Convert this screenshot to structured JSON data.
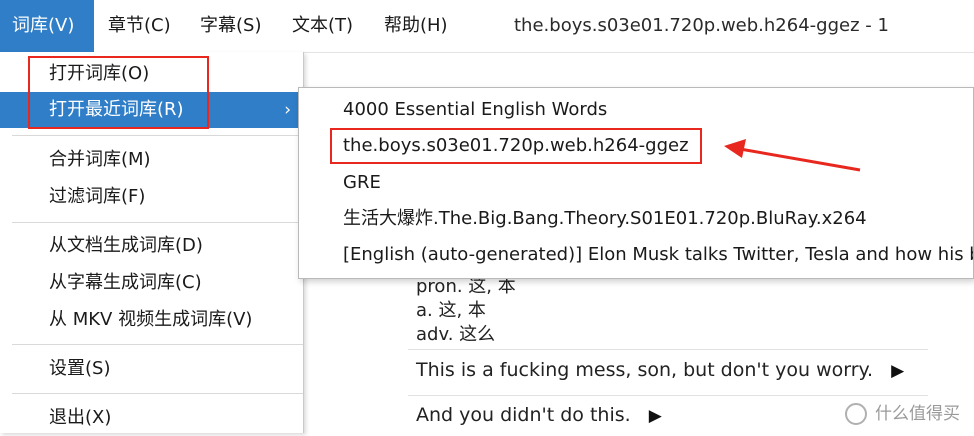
{
  "menubar": {
    "items": [
      {
        "label": "词库(V)"
      },
      {
        "label": "章节(C)"
      },
      {
        "label": "字幕(S)"
      },
      {
        "label": "文本(T)"
      },
      {
        "label": "帮助(H)"
      }
    ],
    "window_title": "the.boys.s03e01.720p.web.h264-ggez - 1"
  },
  "dropdown": {
    "items": [
      {
        "label": "打开词库(O)"
      },
      {
        "label": "打开最近词库(R)",
        "arrow": "›"
      },
      {
        "label": "合并词库(M)"
      },
      {
        "label": "过滤词库(F)"
      },
      {
        "label": "从文档生成词库(D)"
      },
      {
        "label": "从字幕生成词库(C)"
      },
      {
        "label": "从 MKV 视频生成词库(V)"
      },
      {
        "label": "设置(S)"
      },
      {
        "label": "退出(X)"
      }
    ]
  },
  "submenu": {
    "items": [
      {
        "label": "4000 Essential English Words"
      },
      {
        "label": "the.boys.s03e01.720p.web.h264-ggez"
      },
      {
        "label": "GRE"
      },
      {
        "label": "生活大爆炸.The.Big.Bang.Theory.S01E01.720p.BluRay.x264"
      },
      {
        "label": "[English (auto-generated)] Elon Musk talks Twitter, Tesla and how his brain works"
      }
    ]
  },
  "content": {
    "definitions": [
      "pron. 这, 本",
      "a. 这, 本",
      "adv. 这么"
    ],
    "sentences": [
      {
        "text": "This is a fucking mess, son, but don't you worry.",
        "icon": "▶"
      },
      {
        "text": "And you didn't do this.",
        "icon": "▶"
      }
    ]
  },
  "watermark": {
    "text": "什么值得买"
  },
  "colors": {
    "accent": "#2f7ec7",
    "annotation": "#e8281e"
  }
}
